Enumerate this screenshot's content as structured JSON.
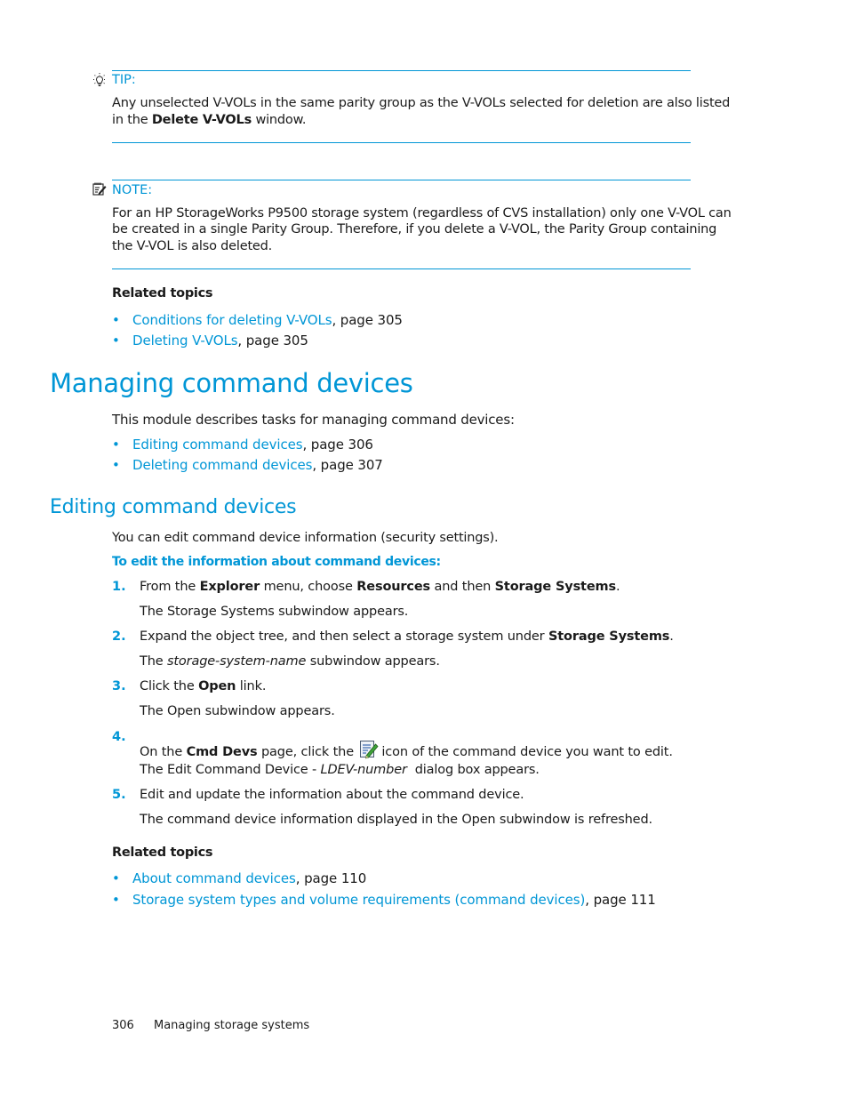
{
  "tip": {
    "label": "TIP:",
    "icon": "lightbulb-icon",
    "text_1": "Any unselected V-VOLs in the same parity group as the V-VOLs selected for deletion are also listed",
    "text_2_pre": "in the ",
    "text_2_bold": "Delete V-VOLs",
    "text_2_post": " window."
  },
  "note": {
    "label": "NOTE:",
    "icon": "note-icon",
    "lines": [
      "For an HP StorageWorks P9500 storage system (regardless of CVS installation) only one V-VOL can",
      "be created in a single Parity Group. Therefore, if you delete a V-VOL, the Parity Group containing",
      "the V-VOL is also deleted."
    ]
  },
  "related_topics_1": {
    "heading": "Related topics",
    "items": [
      {
        "link": "Conditions for deleting V-VOLs",
        "suffix": ", page 305"
      },
      {
        "link": "Deleting V-VOLs",
        "suffix": ", page 305"
      }
    ]
  },
  "managing": {
    "title": "Managing command devices",
    "intro": "This module describes tasks for managing command devices:",
    "items": [
      {
        "link": "Editing command devices",
        "suffix": ", page 306"
      },
      {
        "link": "Deleting command devices",
        "suffix": ", page 307"
      }
    ]
  },
  "editing": {
    "title": "Editing command devices",
    "intro": "You can edit command device information (security settings).",
    "procedure_heading": "To edit the information about command devices:",
    "steps": [
      {
        "num": "1.",
        "parts": [
          "From the ",
          "Explorer",
          " menu, choose ",
          "Resources",
          " and then ",
          "Storage Systems",
          "."
        ],
        "result": "The Storage Systems subwindow appears."
      },
      {
        "num": "2.",
        "parts": [
          "Expand the object tree, and then select a storage system under ",
          "Storage Systems",
          "."
        ],
        "result_pre": "The ",
        "result_italic": "storage-system-name",
        "result_post": " subwindow appears."
      },
      {
        "num": "3.",
        "parts": [
          "Click the ",
          "Open",
          " link."
        ],
        "result": "The Open subwindow appears."
      },
      {
        "num": "4.",
        "parts": [
          "On the ",
          "Cmd Devs",
          " page, click the ",
          "icon of the command device you want to edit."
        ],
        "icon": "edit-icon",
        "result_pre": "The Edit Command Device - ",
        "result_italic": "LDEV-number",
        "result_post": "  dialog box appears."
      },
      {
        "num": "5.",
        "parts": [
          "Edit and update the information about the command device."
        ],
        "result": "The command device information displayed in the Open subwindow is refreshed."
      }
    ]
  },
  "related_topics_2": {
    "heading": "Related topics",
    "items": [
      {
        "link": "About command devices",
        "suffix": ", page 110"
      },
      {
        "link": "Storage system types and volume requirements (command devices)",
        "suffix": ", page 111"
      }
    ]
  },
  "footer": {
    "page_number": "306",
    "chapter": "Managing storage systems"
  },
  "colors": {
    "accent": "#0096d6",
    "text": "#1a1a1a"
  }
}
